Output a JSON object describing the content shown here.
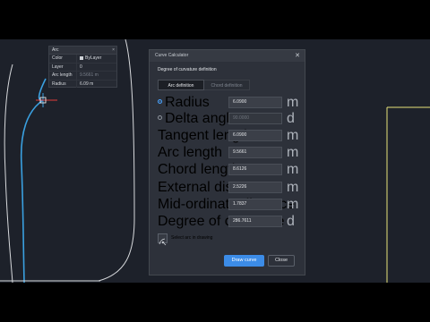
{
  "palette": {
    "title": "Arc",
    "rows": [
      {
        "key": "Color",
        "value": "ByLayer"
      },
      {
        "key": "Layer",
        "value": "0"
      },
      {
        "key": "Arc length",
        "value": "9.5661 m"
      },
      {
        "key": "Radius",
        "value": "6.09 m"
      }
    ]
  },
  "dialog": {
    "title": "Curve Calculator",
    "section": "Degree of curvature definition",
    "tabs": [
      {
        "label": "Arc definition",
        "active": true
      },
      {
        "label": "Chord definition",
        "active": false
      }
    ],
    "fields": [
      {
        "label": "Radius",
        "value": "6.0900",
        "unit": "m",
        "radio": "on"
      },
      {
        "label": "Delta angle",
        "value": "90.0000",
        "unit": "d",
        "radio": "off"
      },
      {
        "label": "Tangent length",
        "value": "6.0900",
        "unit": "m"
      },
      {
        "label": "Arc length",
        "value": "9.5661",
        "unit": "m"
      },
      {
        "label": "Chord length",
        "value": "8.6126",
        "unit": "m"
      },
      {
        "label": "External distance",
        "value": "2.5226",
        "unit": "m"
      },
      {
        "label": "Mid-ordinate distance",
        "value": "1.7837",
        "unit": "m"
      },
      {
        "label": "Degree of curvature",
        "value": "286.7611",
        "unit": "d"
      }
    ],
    "pick_label": "Select arc in drawing",
    "draw_button": "Draw curve",
    "close_button": "Close"
  },
  "colors": {
    "accent": "#3c8ce7",
    "arc": "#3aa0e0",
    "linework": "#d8dadd",
    "yellow_line": "#e8e27a",
    "cursor": "#e23a3a"
  }
}
